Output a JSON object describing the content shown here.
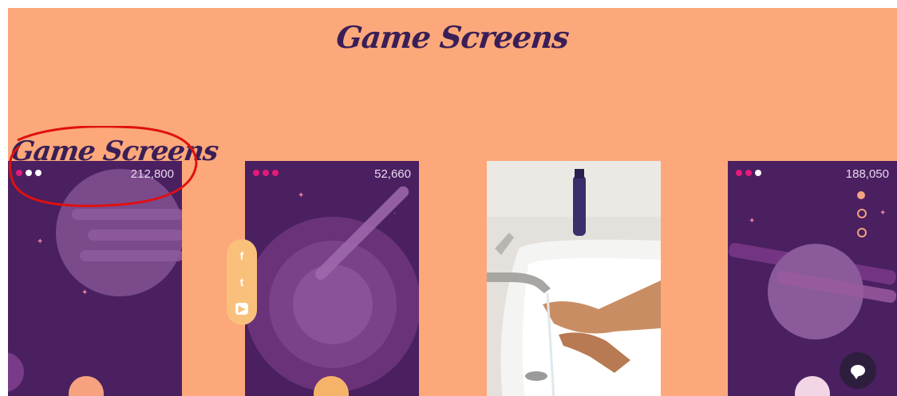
{
  "page": {
    "title": "Game Screens",
    "overlay_title": "Game Screens",
    "background_color": "#fca87a",
    "accent_color": "#3a1f57"
  },
  "cards": [
    {
      "score": "212,800",
      "dots": [
        "#e5197a",
        "#ffffff",
        "#ffffff"
      ]
    },
    {
      "score": "52,660",
      "dots": [
        "#e5197a",
        "#e5197a",
        "#e5197a"
      ]
    },
    {
      "score": "188,050",
      "dots": [
        "#e5197a",
        "#e5197a",
        "#ffffff"
      ]
    }
  ],
  "social": {
    "icons": [
      "facebook-icon",
      "twitter-icon",
      "youtube-icon"
    ],
    "facebook_glyph": "f",
    "twitter_glyph": "t",
    "youtube_glyph": "▶"
  },
  "photo": {
    "subject": "hands-washing-photo"
  },
  "chat": {
    "icon": "chat-bubble-icon"
  },
  "annotation": {
    "color": "#e01010"
  }
}
